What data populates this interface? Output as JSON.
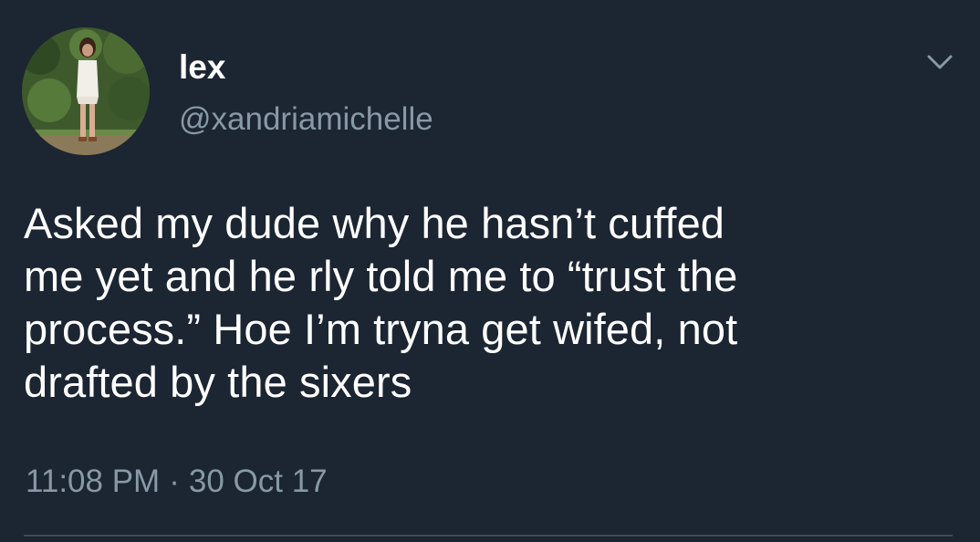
{
  "user": {
    "display_name": "lex",
    "handle": "@xandriamichelle"
  },
  "tweet": {
    "text": "Asked my dude why he hasn’t cuffed\nme yet and he rly told me to “trust the\nprocess.” Hoe I’m tryna get wifed, not\ndrafted by the sixers",
    "time": "11:08 PM",
    "separator": "·",
    "date": "30 Oct 17"
  },
  "icons": {
    "avatar": "profile-photo",
    "menu": "chevron-down-icon"
  },
  "colors": {
    "background": "#1c2532",
    "primary_text": "#ffffff",
    "secondary_text": "#8899a6",
    "divider": "#3d4a59"
  }
}
